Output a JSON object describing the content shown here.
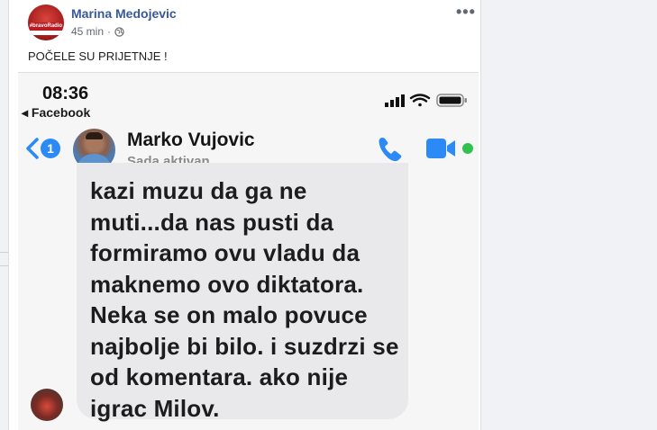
{
  "post": {
    "author": "Marina Medojevic",
    "time": "45 min",
    "separator": "·",
    "text": "POČELE SU PRIJETNJE !",
    "avatar_banner": "#bravoRadio",
    "more_label": "•••"
  },
  "screenshot": {
    "status_time": "08:36",
    "back_app": "◂ Facebook",
    "back_badge": "1",
    "contact_name": "Marko Vujovic",
    "contact_status": "Sada aktivan",
    "message": "kazi muzu da ga ne muti...da nas pusti da formiramo ovu vladu da maknemo ovo diktatora. Neka se on malo povuce najbolje bi bilo. i suzdrzi se od komentara. ako nije igrac Milov.",
    "accent_color": "#2b8af6",
    "online_color": "#31c24d"
  },
  "icons": {
    "globe": "globe-icon",
    "signal": "signal-icon",
    "wifi": "wifi-icon",
    "battery": "battery-icon",
    "phone": "phone-icon",
    "video": "video-camera-icon",
    "back": "chevron-left-icon"
  }
}
